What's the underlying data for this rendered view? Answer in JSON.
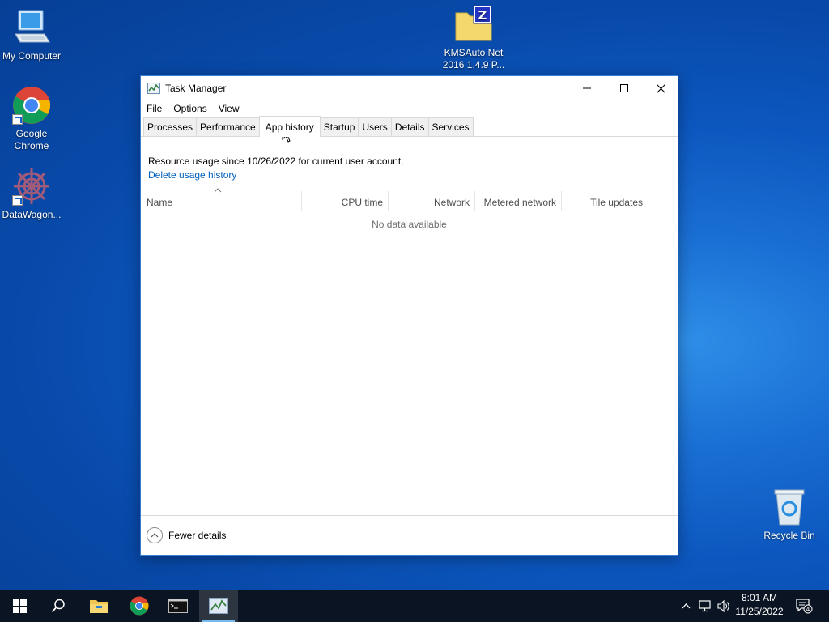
{
  "desktop": {
    "icons": [
      {
        "label": "My Computer"
      },
      {
        "label": "Google Chrome"
      },
      {
        "label": "DataWagon..."
      },
      {
        "label": "KMSAuto Net 2016 1.4.9 P..."
      },
      {
        "label": "Recycle Bin"
      }
    ]
  },
  "window": {
    "title": "Task Manager",
    "menu": [
      "File",
      "Options",
      "View"
    ],
    "tabs": [
      "Processes",
      "Performance",
      "App history",
      "Startup",
      "Users",
      "Details",
      "Services"
    ],
    "active_tab": "App history",
    "resource_text": "Resource usage since 10/26/2022 for current user account.",
    "delete_link": "Delete usage history",
    "columns": [
      "Name",
      "CPU time",
      "Network",
      "Metered network",
      "Tile updates"
    ],
    "empty_text": "No data available",
    "fewer_details": "Fewer details"
  },
  "taskbar": {
    "time": "8:01 AM",
    "date": "11/25/2022",
    "notification_count": "4"
  },
  "colors": {
    "accent": "#0060c0",
    "window_border": "#3a7fd6",
    "taskbar": "#0b1422"
  }
}
